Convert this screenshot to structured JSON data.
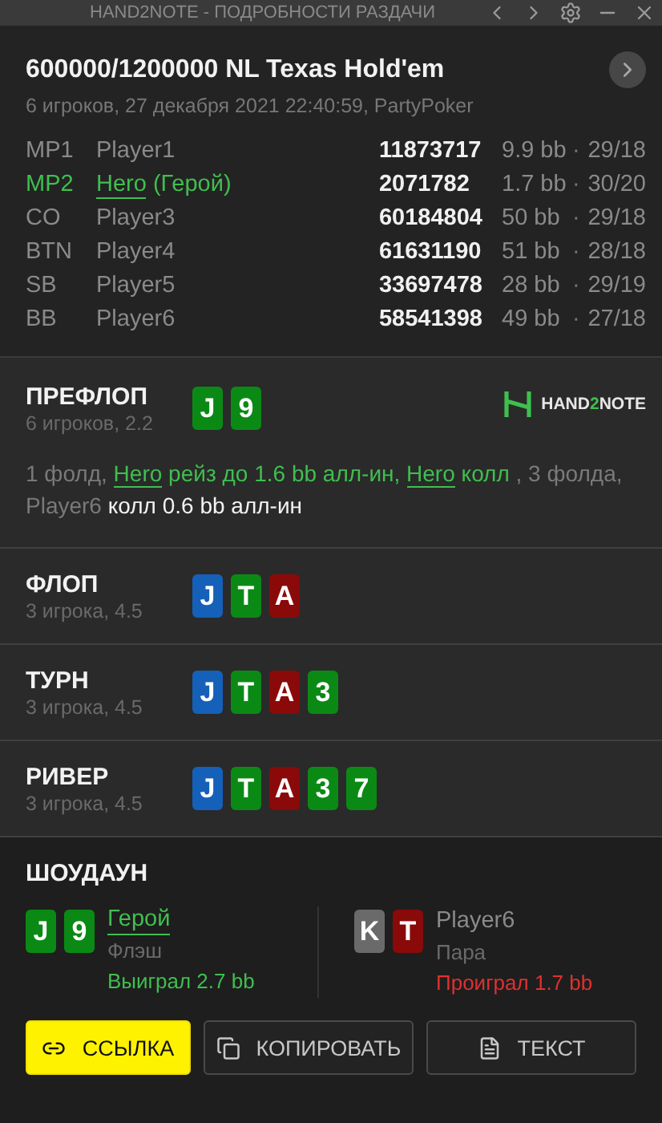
{
  "window": {
    "title": "HAND2NOTE - ПОДРОБНОСТИ РАЗДАЧИ"
  },
  "hand": {
    "title": "600000/1200000 NL Texas Hold'em",
    "subtitle": "6 игроков, 27 декабря 2021 22:40:59, PartyPoker"
  },
  "players": [
    {
      "position": "MP1",
      "name": "Player1",
      "hero": false,
      "stack": "11873717",
      "bb": "9.9 bb",
      "sep": "·",
      "stats": "29/18"
    },
    {
      "position": "MP2",
      "name": "Hero",
      "note": "(Герой)",
      "hero": true,
      "stack": "2071782",
      "bb": "1.7 bb",
      "sep": "·",
      "stats": "30/20"
    },
    {
      "position": "CO",
      "name": "Player3",
      "hero": false,
      "stack": "60184804",
      "bb": "50 bb",
      "sep": "·",
      "stats": "29/18"
    },
    {
      "position": "BTN",
      "name": "Player4",
      "hero": false,
      "stack": "61631190",
      "bb": "51 bb",
      "sep": "·",
      "stats": "28/18"
    },
    {
      "position": "SB",
      "name": "Player5",
      "hero": false,
      "stack": "33697478",
      "bb": "28 bb",
      "sep": "·",
      "stats": "29/19"
    },
    {
      "position": "BB",
      "name": "Player6",
      "hero": false,
      "stack": "58541398",
      "bb": "49 bb",
      "sep": "·",
      "stats": "27/18"
    }
  ],
  "logo": [
    "HAND",
    "2",
    "NOTE"
  ],
  "streets": [
    {
      "name": "ПРЕФЛОП",
      "info": "6 игроков, 2.2",
      "cards": [
        {
          "rank": "J",
          "color": "#0a8a14"
        },
        {
          "rank": "9",
          "color": "#0a8a14"
        }
      ],
      "actions": [
        {
          "kind": "muted",
          "text": "1 фолд, "
        },
        {
          "kind": "link",
          "text": "Hero"
        },
        {
          "kind": "hero",
          "text": " рейз до 1.6 bb алл-ин, "
        },
        {
          "kind": "link",
          "text": "Hero"
        },
        {
          "kind": "hero",
          "text": " колл "
        },
        {
          "kind": "muted",
          "text": ", 3 фолда, Player6 "
        },
        {
          "kind": "bold",
          "text": "колл 0.6 bb алл-ин"
        }
      ]
    },
    {
      "name": "ФЛОП",
      "info": "3 игрока, 4.5",
      "cards": [
        {
          "rank": "J",
          "color": "#1560b8"
        },
        {
          "rank": "T",
          "color": "#0a8a14"
        },
        {
          "rank": "A",
          "color": "#8a0a0a"
        }
      ]
    },
    {
      "name": "ТУРН",
      "info": "3 игрока, 4.5",
      "cards": [
        {
          "rank": "J",
          "color": "#1560b8"
        },
        {
          "rank": "T",
          "color": "#0a8a14"
        },
        {
          "rank": "A",
          "color": "#8a0a0a"
        },
        {
          "rank": "3",
          "color": "#0a8a14"
        }
      ]
    },
    {
      "name": "РИВЕР",
      "info": "3 игрока, 4.5",
      "cards": [
        {
          "rank": "J",
          "color": "#1560b8"
        },
        {
          "rank": "T",
          "color": "#0a8a14"
        },
        {
          "rank": "A",
          "color": "#8a0a0a"
        },
        {
          "rank": "3",
          "color": "#0a8a14"
        },
        {
          "rank": "7",
          "color": "#0a8a14"
        }
      ]
    }
  ],
  "showdown": {
    "title": "ШОУДАУН",
    "players": [
      {
        "name": "Герой",
        "hero": true,
        "won": true,
        "hand": "Флэш",
        "result": "Выиграл 2.7 bb",
        "cards": [
          {
            "rank": "J",
            "color": "#0a8a14"
          },
          {
            "rank": "9",
            "color": "#0a8a14"
          }
        ]
      },
      {
        "name": "Player6",
        "hero": false,
        "won": false,
        "hand": "Пара",
        "result": "Проиграл 1.7 bb",
        "cards": [
          {
            "rank": "K",
            "color": "#6a6a6a"
          },
          {
            "rank": "T",
            "color": "#8a0a0a"
          }
        ]
      }
    ]
  },
  "buttons": [
    {
      "kind": "link",
      "label": "ССЫЛКА",
      "primary": true
    },
    {
      "kind": "copy",
      "label": "КОПИРОВАТЬ",
      "primary": false
    },
    {
      "kind": "text",
      "label": "ТЕКСТ",
      "primary": false
    }
  ]
}
